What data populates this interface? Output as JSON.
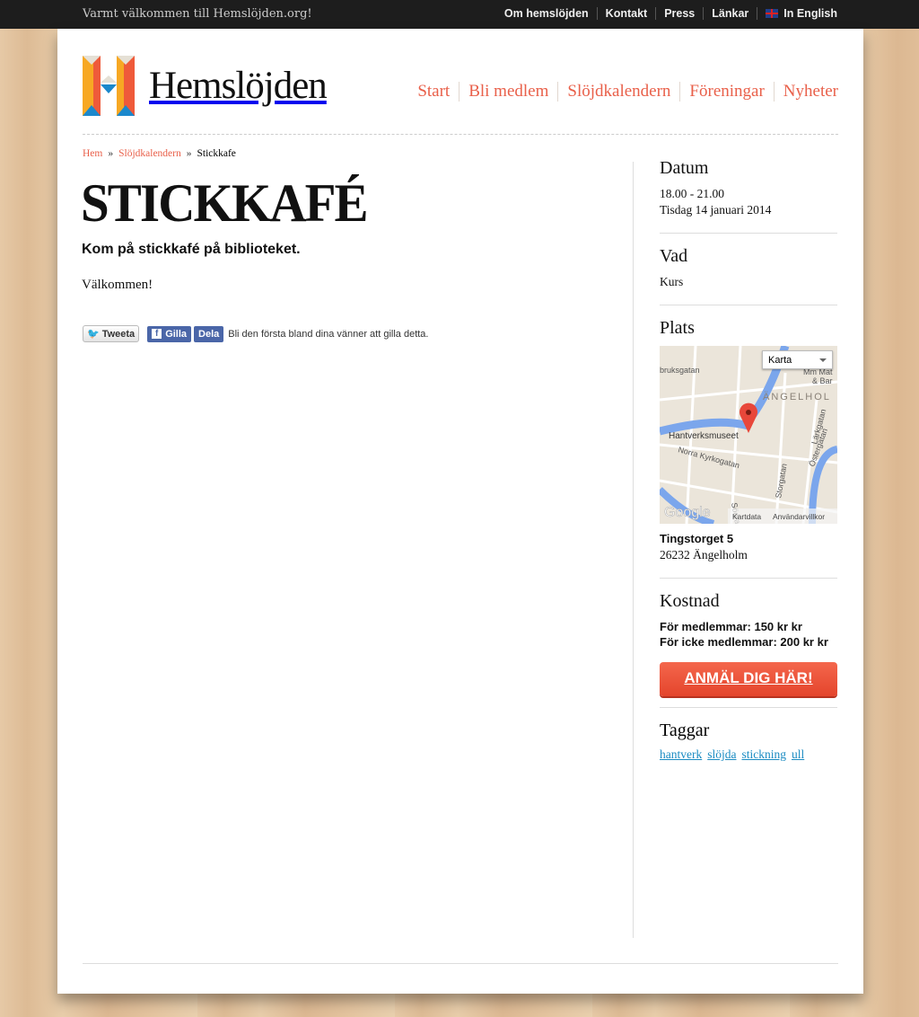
{
  "topbar": {
    "welcome": "Varmt välkommen till Hemslöjden.org!",
    "links": [
      "Om hemslöjden",
      "Kontakt",
      "Press",
      "Länkar",
      "In English"
    ]
  },
  "logo": {
    "text": "Hemslöjden",
    "colors": [
      "#f7a823",
      "#ef5a3a",
      "#1b88cc"
    ]
  },
  "nav": [
    "Start",
    "Bli medlem",
    "Slöjdkalendern",
    "Föreningar",
    "Nyheter"
  ],
  "breadcrumb": {
    "items": [
      "Hem",
      "Slöjdkalendern"
    ],
    "separator": "»",
    "current": "Stickkafe"
  },
  "article": {
    "title": "STICKKAFÉ",
    "lead": "Kom på stickkafé på biblioteket.",
    "body": "Välkommen!"
  },
  "social": {
    "tweet": "Tweeta",
    "like": "Gilla",
    "share": "Dela",
    "like_text": "Bli den första bland dina vänner att gilla detta."
  },
  "sidebar": {
    "datum": {
      "heading": "Datum",
      "time": "18.00 - 21.00",
      "date": "Tisdag 14 januari 2014"
    },
    "vad": {
      "heading": "Vad",
      "value": "Kurs"
    },
    "plats": {
      "heading": "Plats",
      "map": {
        "type_select": "Karta",
        "labels": [
          "bruksgatan",
          "Mm Mat",
          "& Bar",
          "ÄNGELHOL",
          "Hantverksmuseet",
          "Norra Kyrkogatan",
          "Storgatan",
          "Lärkgatan",
          "Östergatan",
          "Södra"
        ],
        "logo": "Google",
        "data": "Kartdata",
        "terms": "Användarvillkor"
      },
      "street": "Tingstorget 5",
      "city": "26232 Ängelholm"
    },
    "kostnad": {
      "heading": "Kostnad",
      "members": "För medlemmar: 150 kr kr",
      "nonmembers": "För icke medlemmar: 200 kr kr",
      "cta": "ANMÄL DIG HÄR!",
      "accent": "#ef5a3a"
    },
    "taggar": {
      "heading": "Taggar",
      "tags": [
        "hantverk",
        "slöjda",
        "stickning",
        "ull"
      ]
    }
  }
}
